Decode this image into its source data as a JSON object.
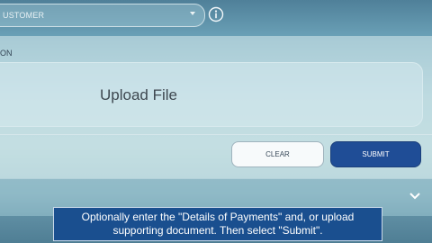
{
  "customer_select": {
    "value": "USTOMER"
  },
  "section": {
    "label": "ON"
  },
  "upload": {
    "label": "Upload File"
  },
  "buttons": {
    "clear": "CLEAR",
    "submit": "SUBMIT"
  },
  "caption": {
    "line1": "Optionally enter the \"Details of Payments\" and, or upload",
    "line2": "supporting document. Then select \"Submit\"."
  },
  "icons": {
    "info": "info-icon",
    "caret": "caret-down-icon",
    "chevron": "chevron-down-icon"
  },
  "colors": {
    "submit_bg": "#1f4d96",
    "caption_bg": "#1a4f8f"
  }
}
